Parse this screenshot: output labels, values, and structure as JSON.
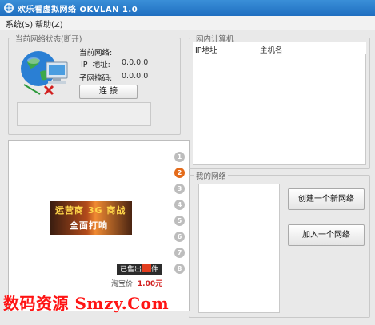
{
  "window": {
    "title": "欢乐看虚拟网络 OKVLAN 1.0",
    "icon": "network-app-icon"
  },
  "menu": {
    "items": [
      {
        "label": "系统(S)"
      },
      {
        "label": "帮助(Z)"
      }
    ]
  },
  "status_group": {
    "title": "当前网络状态(断开)",
    "image_icon": "globe-computer-network-icon",
    "current_network_label": "当前网络:",
    "ip_label": "IP  地址:",
    "ip_value": "0.0.0.0",
    "subnet_label": "子网掩码:",
    "subnet_value": "0.0.0.0",
    "connect_button": "连 接"
  },
  "ad": {
    "bullets": [
      "1",
      "2",
      "3",
      "4",
      "5",
      "6",
      "7",
      "8"
    ],
    "active_bullet": 2,
    "banner_line1": "运营商 3G 商战",
    "banner_line2": "全面打响",
    "sold_prefix": "已售出",
    "sold_suffix": "件",
    "price_label": "淘宝价:",
    "price_value": "1.00元"
  },
  "lan_group": {
    "title": "网内计算机",
    "columns": [
      "IP地址",
      "主机名"
    ],
    "rows": []
  },
  "my_network_group": {
    "title": "我的网络",
    "create_button": "创建一个新网络",
    "join_button": "加入一个网络"
  },
  "watermark": "数码资源 Smzy.Com",
  "colors": {
    "titlebar": "#1f6ec0",
    "window_bg": "#e9e9e9",
    "watermark": "#ff1414",
    "active_bullet": "#e46b1a"
  }
}
